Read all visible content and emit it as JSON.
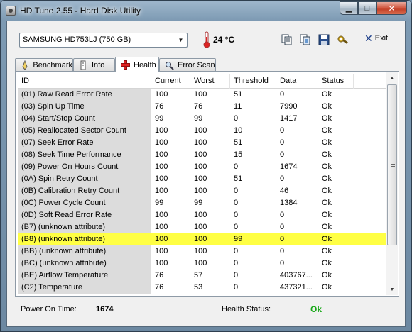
{
  "window": {
    "title": "HD Tune 2.55 - Hard Disk Utility"
  },
  "toolbar": {
    "drive": "SAMSUNG HD753LJ (750 GB)",
    "temperature": "24 °C",
    "exit_label": "Exit"
  },
  "tabs": [
    {
      "label": "Benchmark",
      "icon": "gauge-icon"
    },
    {
      "label": "Info",
      "icon": "info-icon"
    },
    {
      "label": "Health",
      "icon": "health-cross-icon",
      "active": true
    },
    {
      "label": "Error Scan",
      "icon": "magnifier-icon"
    }
  ],
  "table": {
    "columns": [
      "ID",
      "Current",
      "Worst",
      "Threshold",
      "Data",
      "Status"
    ],
    "highlight_color": "#ffff44",
    "rows": [
      [
        "(01) Raw Read Error Rate",
        "100",
        "100",
        "51",
        "0",
        "Ok"
      ],
      [
        "(03) Spin Up Time",
        "76",
        "76",
        "11",
        "7990",
        "Ok"
      ],
      [
        "(04) Start/Stop Count",
        "99",
        "99",
        "0",
        "1417",
        "Ok"
      ],
      [
        "(05) Reallocated Sector Count",
        "100",
        "100",
        "10",
        "0",
        "Ok"
      ],
      [
        "(07) Seek Error Rate",
        "100",
        "100",
        "51",
        "0",
        "Ok"
      ],
      [
        "(08) Seek Time Performance",
        "100",
        "100",
        "15",
        "0",
        "Ok"
      ],
      [
        "(09) Power On Hours Count",
        "100",
        "100",
        "0",
        "1674",
        "Ok"
      ],
      [
        "(0A) Spin Retry Count",
        "100",
        "100",
        "51",
        "0",
        "Ok"
      ],
      [
        "(0B) Calibration Retry Count",
        "100",
        "100",
        "0",
        "46",
        "Ok"
      ],
      [
        "(0C) Power Cycle Count",
        "99",
        "99",
        "0",
        "1384",
        "Ok"
      ],
      [
        "(0D) Soft Read Error Rate",
        "100",
        "100",
        "0",
        "0",
        "Ok"
      ],
      [
        "(B7) (unknown attribute)",
        "100",
        "100",
        "0",
        "0",
        "Ok"
      ],
      [
        "(B8) (unknown attribute)",
        "100",
        "100",
        "99",
        "0",
        "Ok"
      ],
      [
        "(BB) (unknown attribute)",
        "100",
        "100",
        "0",
        "0",
        "Ok"
      ],
      [
        "(BC) (unknown attribute)",
        "100",
        "100",
        "0",
        "0",
        "Ok"
      ],
      [
        "(BE) Airflow Temperature",
        "76",
        "57",
        "0",
        "403767...",
        "Ok"
      ],
      [
        "(C2) Temperature",
        "76",
        "53",
        "0",
        "437321...",
        "Ok"
      ]
    ],
    "highlighted_row": 12
  },
  "footer": {
    "power_on_label": "Power On Time:",
    "power_on_value": "1674",
    "health_label": "Health Status:",
    "health_value": "Ok",
    "health_color": "#1aa81a"
  }
}
